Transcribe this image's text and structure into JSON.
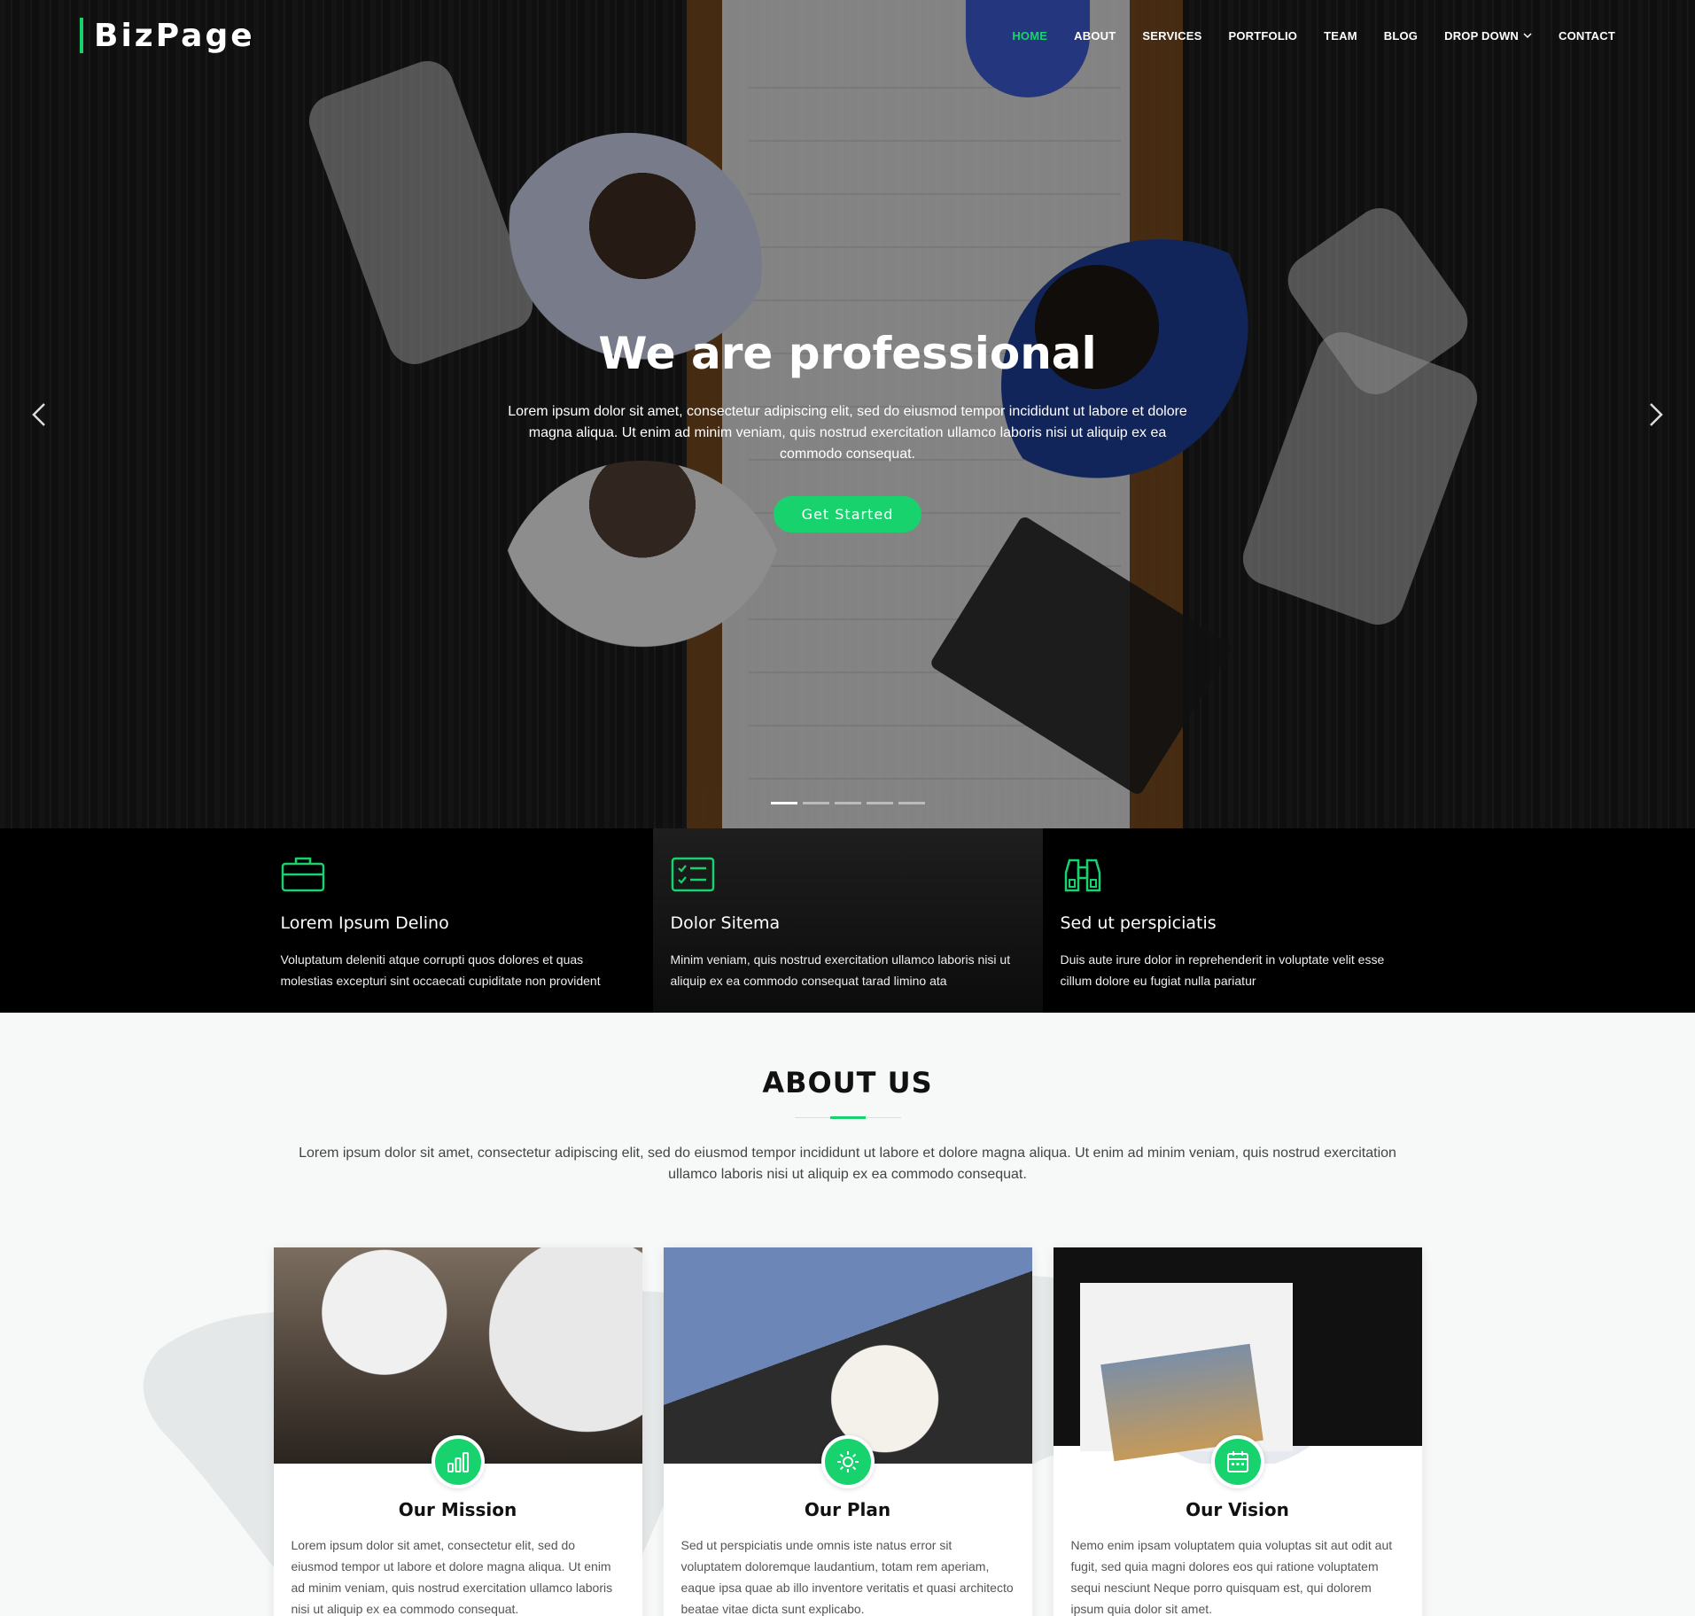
{
  "colors": {
    "accent": "#18d26e"
  },
  "header": {
    "logo": "BizPage",
    "nav": [
      {
        "label": "HOME",
        "active": true
      },
      {
        "label": "ABOUT"
      },
      {
        "label": "SERVICES"
      },
      {
        "label": "PORTFOLIO"
      },
      {
        "label": "TEAM"
      },
      {
        "label": "BLOG"
      },
      {
        "label": "DROP DOWN",
        "icon": "chevron-down-icon"
      },
      {
        "label": "CONTACT"
      }
    ]
  },
  "hero": {
    "title": "We are professional",
    "text": "Lorem ipsum dolor sit amet, consectetur adipiscing elit, sed do eiusmod tempor incididunt ut labore et dolore magna aliqua. Ut enim ad minim veniam, quis nostrud exercitation ullamco laboris nisi ut aliquip ex ea commodo consequat.",
    "button": "Get Started",
    "slides": 5,
    "active_slide": 1
  },
  "features": [
    {
      "icon": "briefcase-icon",
      "title": "Lorem Ipsum Delino",
      "text": "Voluptatum deleniti atque corrupti quos dolores et quas molestias excepturi sint occaecati cupiditate non provident"
    },
    {
      "icon": "checklist-icon",
      "title": "Dolor Sitema",
      "text": "Minim veniam, quis nostrud exercitation ullamco laboris nisi ut aliquip ex ea commodo consequat tarad limino ata"
    },
    {
      "icon": "binoculars-icon",
      "title": "Sed ut perspiciatis",
      "text": "Duis aute irure dolor in reprehenderit in voluptate velit esse cillum dolore eu fugiat nulla pariatur"
    }
  ],
  "about": {
    "title": "ABOUT US",
    "intro": "Lorem ipsum dolor sit amet, consectetur adipiscing elit, sed do eiusmod tempor incididunt ut labore et dolore magna aliqua. Ut enim ad minim veniam, quis nostrud exercitation ullamco laboris nisi ut aliquip ex ea commodo consequat.",
    "cards": [
      {
        "icon": "bar-chart-icon",
        "title": "Our Mission",
        "text": "Lorem ipsum dolor sit amet, consectetur elit, sed do eiusmod tempor ut labore et dolore magna aliqua. Ut enim ad minim veniam, quis nostrud exercitation ullamco laboris nisi ut aliquip ex ea commodo consequat."
      },
      {
        "icon": "sun-icon",
        "title": "Our Plan",
        "text": "Sed ut perspiciatis unde omnis iste natus error sit voluptatem doloremque laudantium, totam rem aperiam, eaque ipsa quae ab illo inventore veritatis et quasi architecto beatae vitae dicta sunt explicabo."
      },
      {
        "icon": "calendar-icon",
        "title": "Our Vision",
        "text": "Nemo enim ipsam voluptatem quia voluptas sit aut odit aut fugit, sed quia magni dolores eos qui ratione voluptatem sequi nesciunt Neque porro quisquam est, qui dolorem ipsum quia dolor sit amet."
      }
    ]
  }
}
